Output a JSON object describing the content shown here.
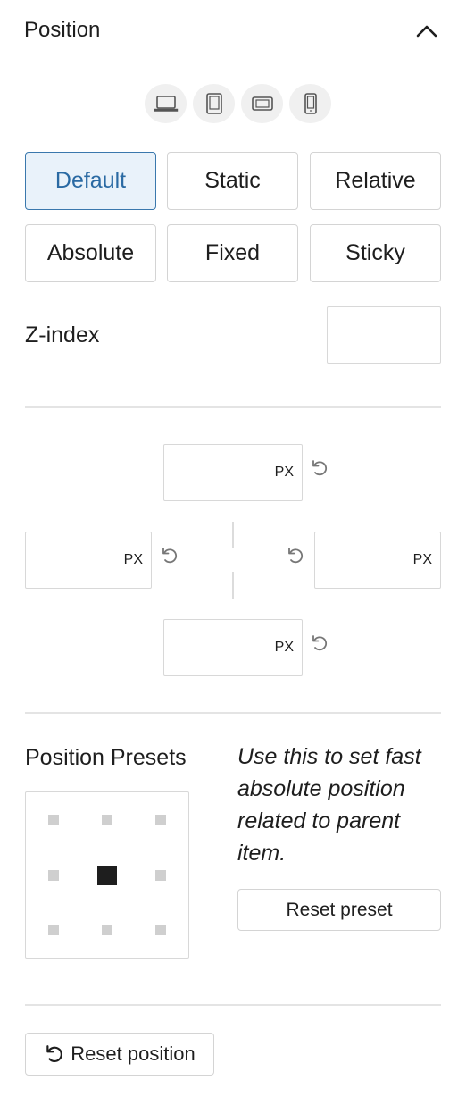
{
  "panel": {
    "title": "Position"
  },
  "devices": [
    "desktop-icon",
    "tablet-icon",
    "tablet-landscape-icon",
    "mobile-icon"
  ],
  "position_types": [
    "Default",
    "Static",
    "Relative",
    "Absolute",
    "Fixed",
    "Sticky"
  ],
  "selected_position": "Default",
  "zindex": {
    "label": "Z-index",
    "value": ""
  },
  "offsets": {
    "top": {
      "value": "",
      "unit": "PX"
    },
    "left": {
      "value": "",
      "unit": "PX"
    },
    "right": {
      "value": "",
      "unit": "PX"
    },
    "bottom": {
      "value": "",
      "unit": "PX"
    }
  },
  "presets": {
    "label": "Position Presets",
    "help": "Use this to set fast absolute position related to parent item.",
    "reset_label": "Reset preset",
    "selected": "center"
  },
  "reset_position_label": "Reset position",
  "colors": {
    "accent": "#2a6aa3",
    "active_bg": "#e9f2fa",
    "border": "#d4d4d4"
  }
}
